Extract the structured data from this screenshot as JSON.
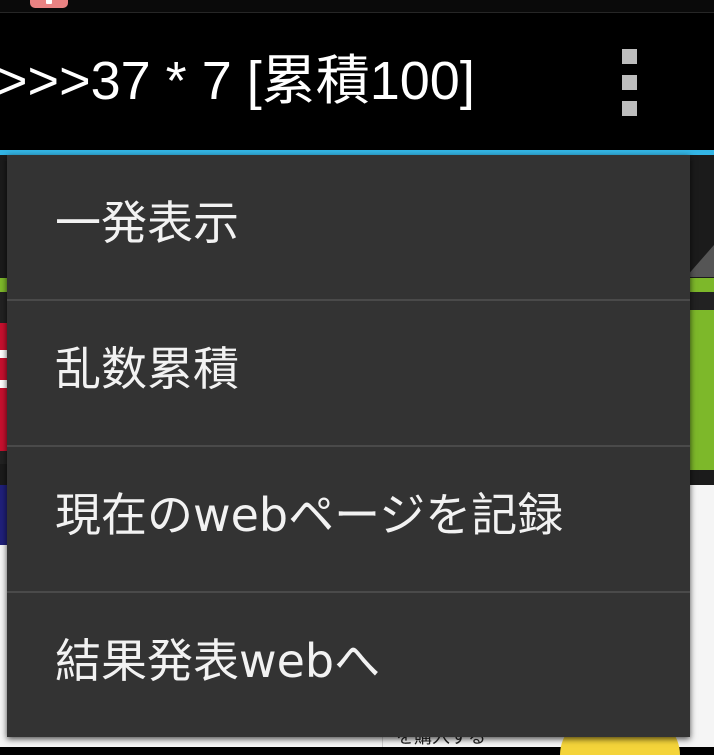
{
  "action_bar": {
    "title": ">>>37 * 7 [累積100]",
    "overflow_icon": "more-vert-icon"
  },
  "accent_color": "#33b5e5",
  "menu": {
    "items": [
      {
        "label": "一発表示"
      },
      {
        "label": "乱数累積"
      },
      {
        "label": "現在のwebページを記録"
      },
      {
        "label": "結果発表webへ"
      }
    ]
  },
  "background": {
    "partial_text": "を購入する"
  }
}
